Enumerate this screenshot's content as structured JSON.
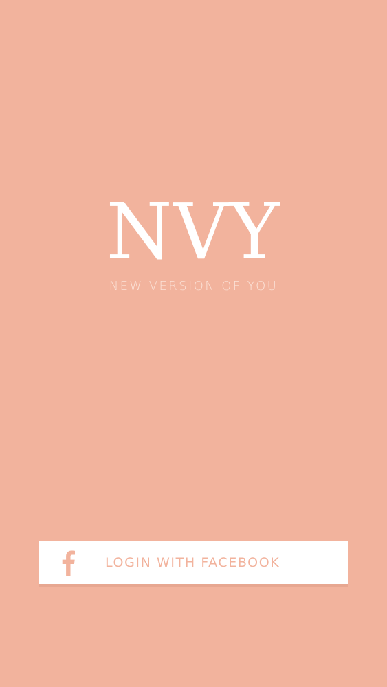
{
  "logo": {
    "title": "NVY",
    "tagline": "NEW VERSION OF YOU"
  },
  "login": {
    "label": "LOGIN WITH FACEBOOK",
    "icon": "facebook-icon"
  },
  "colors": {
    "background": "#f2b39d",
    "button": "#ffffff",
    "accent": "#f2b39d"
  }
}
